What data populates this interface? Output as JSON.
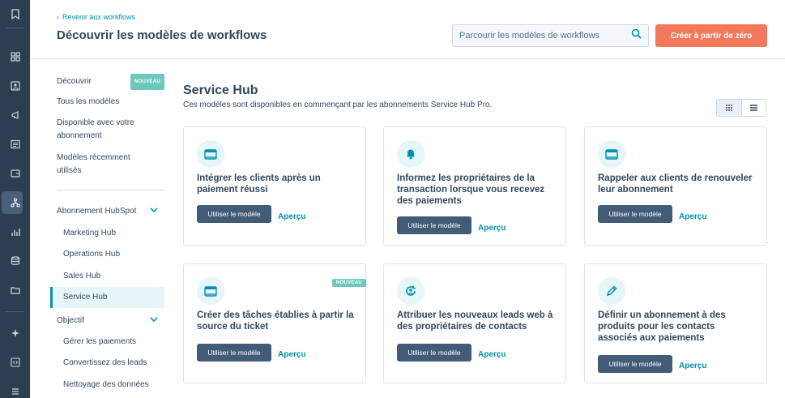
{
  "header": {
    "back_label": "Revenir aux workflows",
    "title": "Découvrir les modèles de workflows",
    "search_placeholder": "Parcourir les modèles de workflows",
    "create_label": "Créer à partir de zéro"
  },
  "sidebar": {
    "discover": "Découvrir",
    "discover_badge": "NOUVEAU",
    "all_models": "Tous les modèles",
    "available_1": "Disponible avec votre",
    "available_2": "abonnement",
    "recent_1": "Modèles récemment",
    "recent_2": "utilisés",
    "subscription_section": "Abonnement HubSpot",
    "hubs": [
      "Marketing Hub",
      "Operations Hub",
      "Sales Hub",
      "Service Hub"
    ],
    "objective_section": "Objectif",
    "objectives": [
      "Gérer les paiements",
      "Convertissez des leads",
      "Nettoyage des données"
    ]
  },
  "main": {
    "title": "Service Hub",
    "subtitle": "Ces modèles sont disponibles en commençant par les abonnements Service Hub Pro.",
    "use_label": "Utiliser le modèle",
    "preview_label": "Aperçu",
    "cards": [
      {
        "title": "Intégrer les clients après un paiement réussi",
        "icon": "browser-window-icon"
      },
      {
        "title": "Informez les propriétaires de la transaction lorsque vous recevez des paiements",
        "icon": "bell-icon"
      },
      {
        "title": "Rappeler aux clients de renouveler leur abonnement",
        "icon": "browser-window-icon"
      },
      {
        "title": "Créer des tâches établies à partir la source du ticket",
        "icon": "browser-window-icon",
        "badge": "NOUVEAU"
      },
      {
        "title": "Attribuer les nouveaux leads web à des propriétaires de contacts",
        "icon": "assign-cycle-icon"
      },
      {
        "title": "Définir un abonnement à des produits pour les contacts associés aux paiements",
        "icon": "pencil-icon"
      }
    ]
  },
  "colors": {
    "rail": "#2d3e50",
    "accent": "#f2795b",
    "link": "#0091ae",
    "button": "#425b76",
    "badge": "#6cc8bb"
  }
}
